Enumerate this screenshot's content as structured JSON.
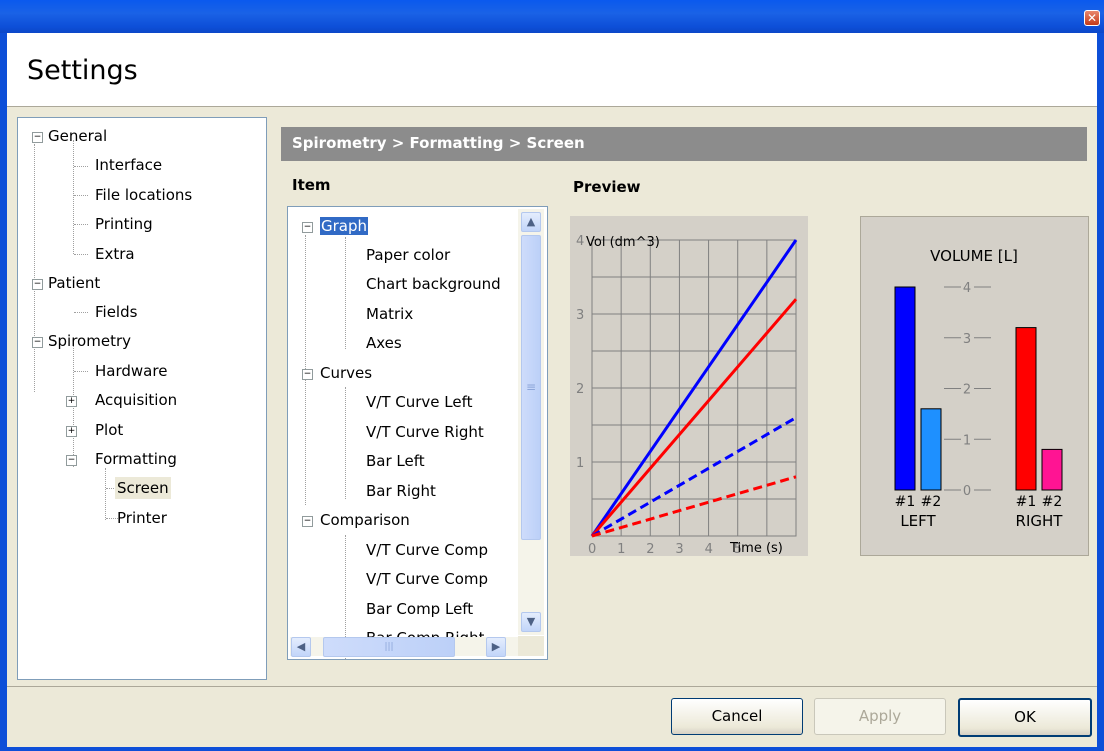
{
  "window": {
    "title": "Settings",
    "close_glyph": "✕"
  },
  "nav": {
    "items": [
      {
        "label": "General",
        "expander": "−"
      },
      {
        "label": "Interface"
      },
      {
        "label": "File locations"
      },
      {
        "label": "Printing"
      },
      {
        "label": "Extra"
      },
      {
        "label": "Patient",
        "expander": "−"
      },
      {
        "label": "Fields"
      },
      {
        "label": "Spirometry",
        "expander": "−"
      },
      {
        "label": "Hardware"
      },
      {
        "label": "Acquisition",
        "expander": "+"
      },
      {
        "label": "Plot",
        "expander": "+"
      },
      {
        "label": "Formatting",
        "expander": "−"
      },
      {
        "label": "Screen",
        "selected": true
      },
      {
        "label": "Printer"
      }
    ]
  },
  "main": {
    "breadcrumb": "Spirometry > Formatting > Screen",
    "item_label": "Item",
    "preview_label": "Preview"
  },
  "item_tree": {
    "items": [
      {
        "label": "Graph",
        "expander": "−",
        "selected": true
      },
      {
        "label": "Paper color"
      },
      {
        "label": "Chart background"
      },
      {
        "label": "Matrix"
      },
      {
        "label": "Axes"
      },
      {
        "label": "Curves",
        "expander": "−"
      },
      {
        "label": "V/T Curve Left"
      },
      {
        "label": "V/T Curve Right"
      },
      {
        "label": "Bar Left"
      },
      {
        "label": "Bar Right"
      },
      {
        "label": "Comparison",
        "expander": "−"
      },
      {
        "label": "V/T Curve Comp"
      },
      {
        "label": "V/T Curve Comp"
      },
      {
        "label": "Bar Comp Left"
      },
      {
        "label": "Bar Comp Right"
      }
    ],
    "scroll_glyphs": {
      "up": "▲",
      "down": "▼",
      "left": "◀",
      "right": "▶",
      "grip": "≡",
      "hgrip": "|||"
    }
  },
  "chart_data": [
    {
      "type": "line",
      "ylabel": "Vol (dm^3)",
      "xlabel": "Time (s)",
      "x_ticks": [
        "0",
        "1",
        "2",
        "3",
        "4",
        "5"
      ],
      "y_ticks": [
        "1",
        "2",
        "3",
        "4"
      ],
      "xlim": [
        0,
        7
      ],
      "ylim": [
        0,
        4
      ],
      "grid": true,
      "series": [
        {
          "color": "#0000ff",
          "dash": false,
          "x": [
            0,
            7
          ],
          "y": [
            0,
            4.0
          ]
        },
        {
          "color": "#ff0000",
          "dash": false,
          "x": [
            0,
            7
          ],
          "y": [
            0,
            3.2
          ]
        },
        {
          "color": "#0000ff",
          "dash": true,
          "x": [
            0,
            7
          ],
          "y": [
            0,
            1.6
          ]
        },
        {
          "color": "#ff0000",
          "dash": true,
          "x": [
            0,
            7
          ],
          "y": [
            0,
            0.8
          ]
        }
      ]
    },
    {
      "type": "bar",
      "title": "VOLUME [L]",
      "y_ticks": [
        "0",
        "1",
        "2",
        "3",
        "4"
      ],
      "ylim": [
        0,
        4
      ],
      "groups": [
        {
          "label": "LEFT",
          "bars": [
            {
              "label": "#1",
              "value": 4.0,
              "color": "#0000ff"
            },
            {
              "label": "#2",
              "value": 1.6,
              "color": "#1e90ff"
            }
          ]
        },
        {
          "label": "RIGHT",
          "bars": [
            {
              "label": "#1",
              "value": 3.2,
              "color": "#ff0000"
            },
            {
              "label": "#2",
              "value": 0.8,
              "color": "#ff1493"
            }
          ]
        }
      ]
    }
  ],
  "buttons": {
    "cancel": "Cancel",
    "apply": "Apply",
    "ok": "OK"
  }
}
